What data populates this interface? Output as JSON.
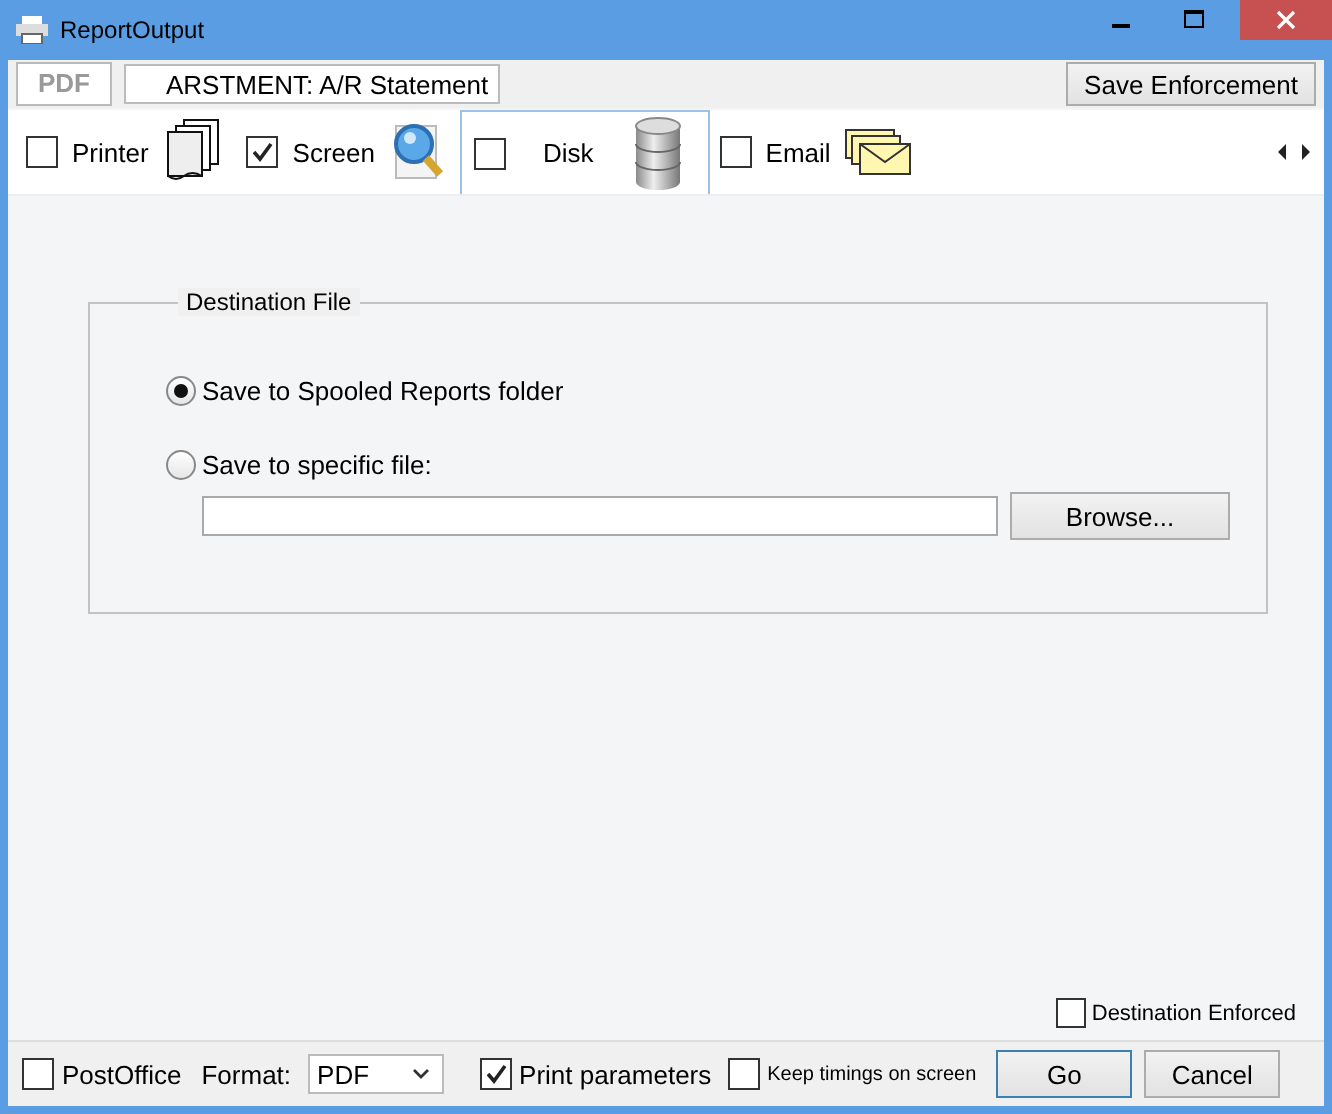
{
  "window": {
    "title": "ReportOutput"
  },
  "header": {
    "format_badge": "PDF",
    "report_name": "ARSTMENT: A/R Statement",
    "save_button": "Save Enforcement"
  },
  "tabs": [
    {
      "label": "Printer",
      "kind": "printer",
      "checked": false,
      "selected": false
    },
    {
      "label": "Screen",
      "kind": "screen",
      "checked": true,
      "selected": false
    },
    {
      "label": "Disk",
      "kind": "disk",
      "checked": false,
      "selected": true
    },
    {
      "label": "Email",
      "kind": "email",
      "checked": false,
      "selected": false
    }
  ],
  "destination": {
    "title": "Destination File",
    "options": [
      {
        "label": "Save to Spooled Reports folder",
        "selected": true
      },
      {
        "label": "Save to specific file:",
        "selected": false
      }
    ],
    "browse_button": "Browse..."
  },
  "destination_enforced": {
    "label": "Destination Enforced",
    "checked": false
  },
  "footer": {
    "postoffice": {
      "label": "PostOffice",
      "checked": false
    },
    "format_label": "Format:",
    "format_value": "PDF",
    "print_parameters": {
      "label": "Print parameters",
      "checked": true
    },
    "keep_timings": {
      "label": "Keep timings on screen",
      "checked": false
    },
    "buttons": [
      "Go",
      "Cancel"
    ]
  }
}
